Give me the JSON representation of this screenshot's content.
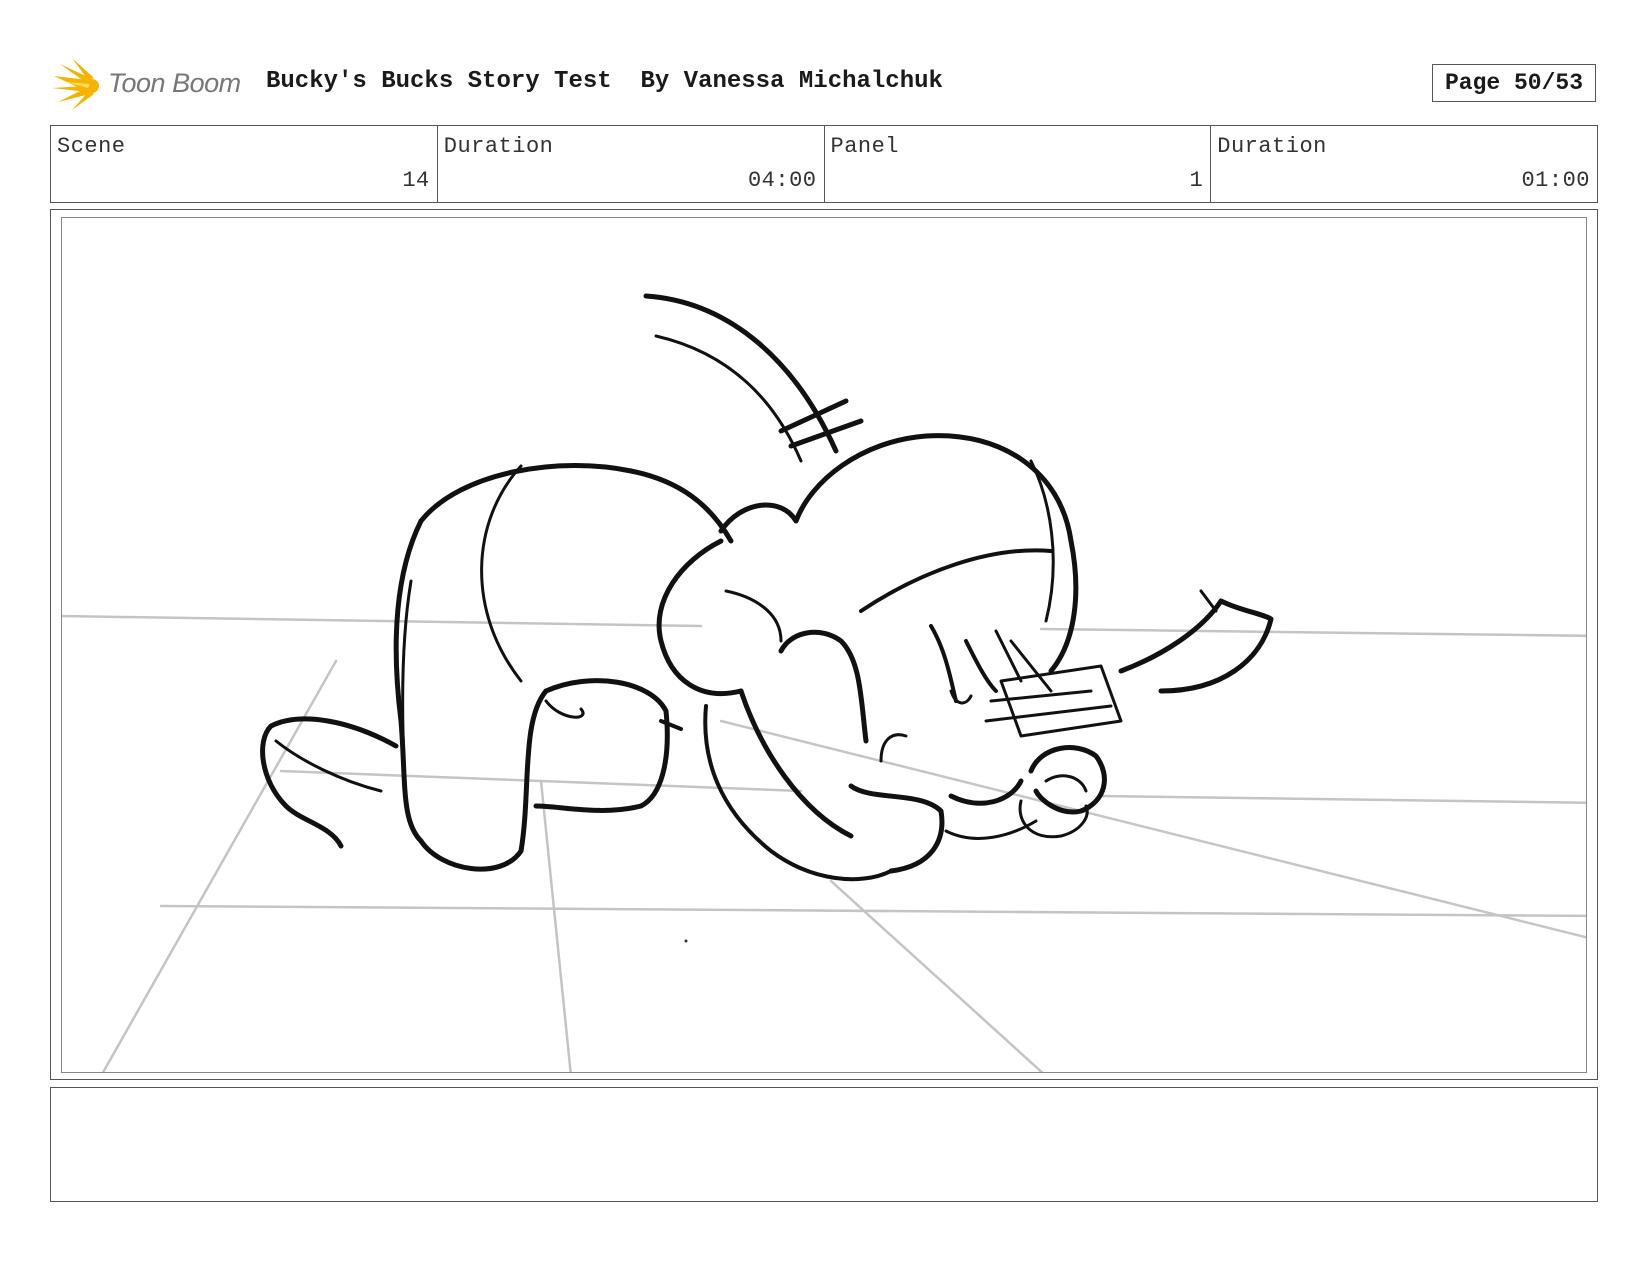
{
  "header": {
    "logo_text": "Toon Boom",
    "title": "Bucky's Bucks Story Test  By Vanessa Michalchuk",
    "page_label": "Page 50/53"
  },
  "info": {
    "scene_label": "Scene",
    "scene_value": "14",
    "scene_duration_label": "Duration",
    "scene_duration_value": "04:00",
    "panel_label": "Panel",
    "panel_value": "1",
    "panel_duration_label": "Duration",
    "panel_duration_value": "01:00"
  },
  "colors": {
    "logo_accent": "#f5b400",
    "sketch_ink": "#111111",
    "guide_lines": "#bdbdbd"
  },
  "notes": {
    "text": ""
  }
}
